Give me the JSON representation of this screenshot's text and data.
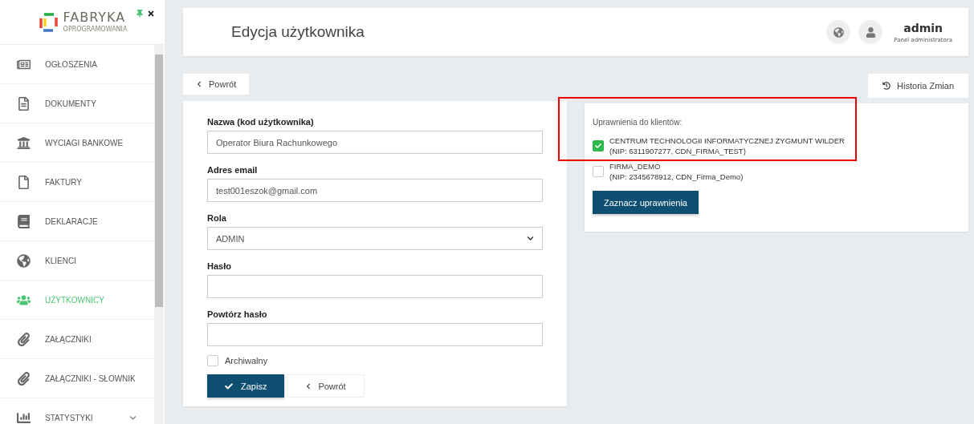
{
  "logo": {
    "name": "FABRYKA",
    "tagline": "OPROGRAMOWANIA"
  },
  "sidebar": {
    "pinned": true,
    "items": [
      {
        "label": "OGŁOSZENIA",
        "selected": false
      },
      {
        "label": "DOKUMENTY",
        "selected": false
      },
      {
        "label": "WYCIAGI BANKOWE",
        "selected": false
      },
      {
        "label": "FAKTURY",
        "selected": false
      },
      {
        "label": "DEKLARACJE",
        "selected": false
      },
      {
        "label": "KLIENCI",
        "selected": false
      },
      {
        "label": "UŻYTKOWNICY",
        "selected": true
      },
      {
        "label": "ZAŁĄCZNIKI",
        "selected": false
      },
      {
        "label": "ZAŁĄCZNIKI - SŁOWNIK",
        "selected": false
      },
      {
        "label": "STATYSTYKI",
        "selected": false,
        "expanded": false
      }
    ]
  },
  "header": {
    "title": "Edycja użytkownika",
    "user": "admin",
    "role": "Panel administratora"
  },
  "back_button": "Powrót",
  "history_button": "Historia Zmian",
  "form": {
    "fields": [
      {
        "kind": "text",
        "label": "Nazwa (kod użytkownika)",
        "value": "Operator Biura Rachunkowego"
      },
      {
        "kind": "text",
        "label": "Adres email",
        "value": "test001eszok@gmail.com"
      },
      {
        "kind": "select",
        "label": "Rola",
        "value": "ADMIN"
      },
      {
        "kind": "password",
        "label": "Hasło"
      },
      {
        "kind": "password",
        "label": "Powtórz hasło"
      }
    ],
    "archive": {
      "label": "Archiwalny",
      "checked": false
    },
    "save_button": "Zapisz",
    "back_button": "Powrót"
  },
  "permissions": {
    "title": "Uprawnienia do klientów:",
    "clients": [
      {
        "name": "CENTRUM TECHNOLOGII INFORMATYCZNEJ ZYGMUNT WILDER",
        "details": "(NIP: 6311907277, CDN_FIRMA_TEST)",
        "checked": true,
        "highlighted": true
      },
      {
        "name": "FIRMA_DEMO",
        "details": "(NIP: 2345678912, CDN_Firma_Demo)",
        "checked": false,
        "highlighted": false
      }
    ],
    "button": "Zaznacz uprawnienia"
  }
}
